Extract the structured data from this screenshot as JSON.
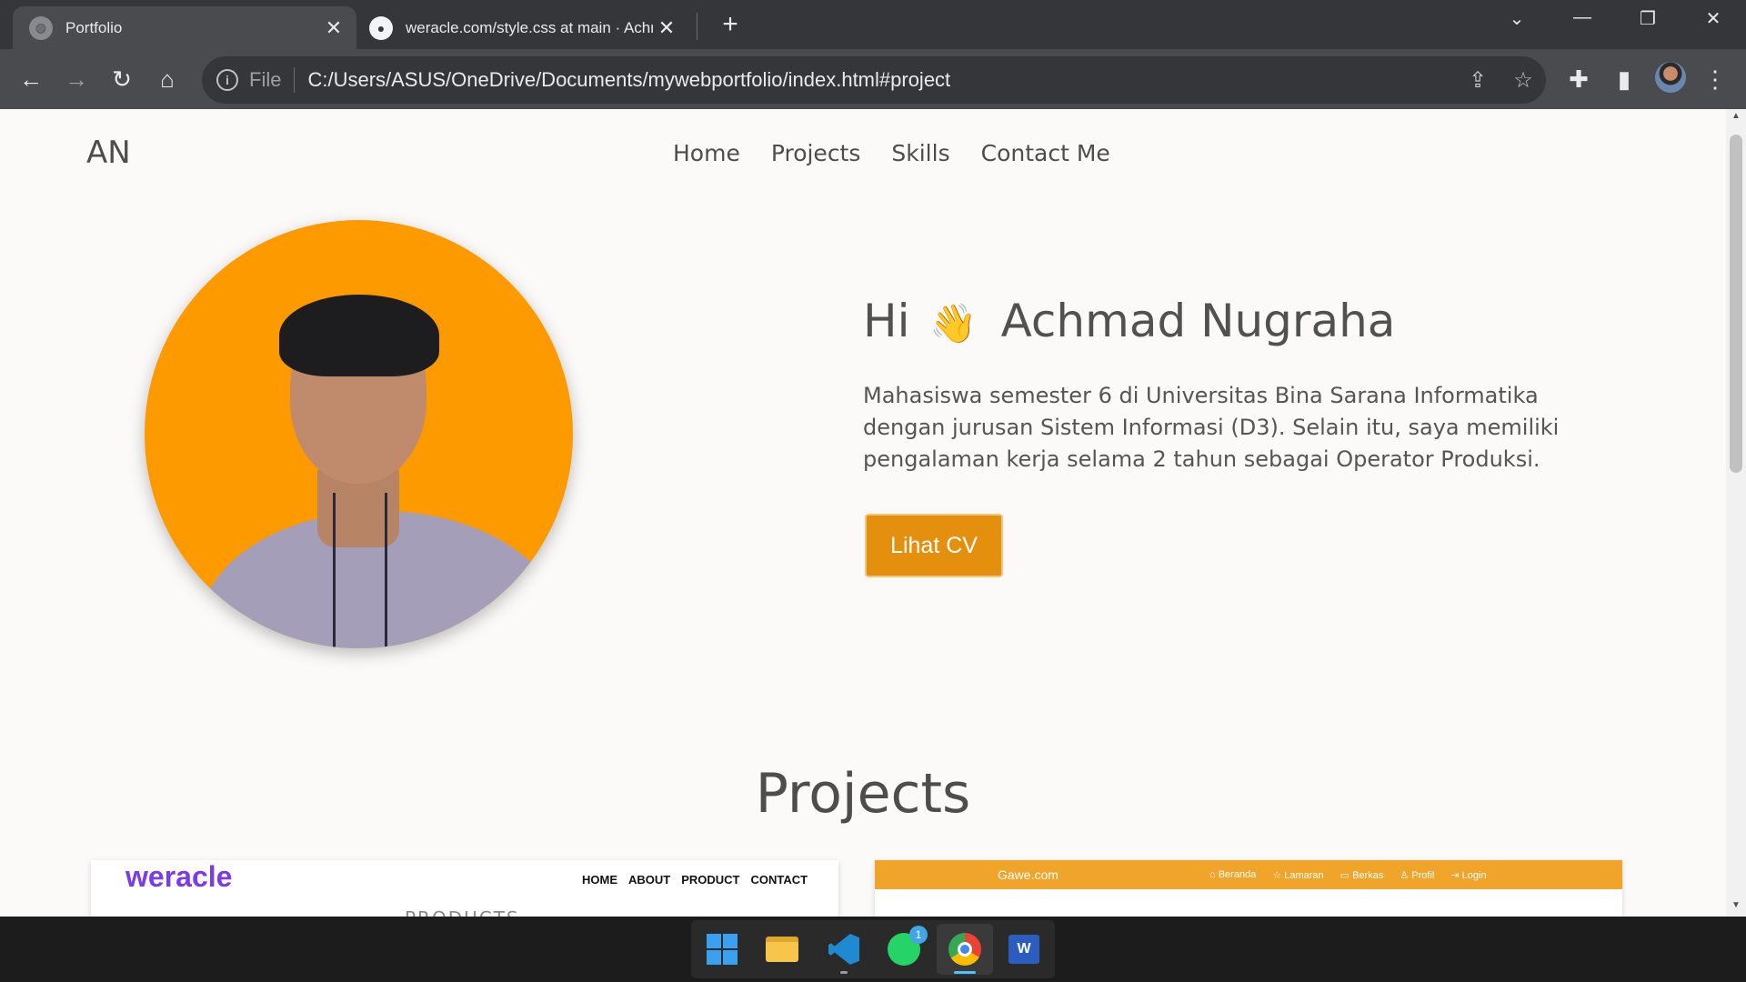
{
  "browser": {
    "tabs": [
      {
        "title": "Portfolio",
        "icon": "globe-icon",
        "active": true
      },
      {
        "title": "weracle.com/style.css at main · Achm",
        "icon": "github-icon",
        "active": false
      }
    ],
    "address": {
      "prefix": "File",
      "url": "C:/Users/ASUS/OneDrive/Documents/mywebportfolio/index.html#project"
    }
  },
  "page": {
    "logo": "AN",
    "nav": [
      "Home",
      "Projects",
      "Skills",
      "Contact Me"
    ],
    "hero": {
      "greeting": "Hi",
      "wave": "👋",
      "name": "Achmad Nugraha",
      "description": "Mahasiswa semester 6 di Universitas Bina Sarana Informatika dengan jurusan Sistem Informasi (D3). Selain itu, saya memiliki pengalaman kerja selama 2 tahun sebagai Operator Produksi.",
      "cv_button": "Lihat CV"
    },
    "projects": {
      "title": "Projects",
      "card1": {
        "brand": "weracle",
        "menu": [
          "HOME",
          "ABOUT",
          "PRODUCT",
          "CONTACT"
        ],
        "sub": "PRODUCTS"
      },
      "card2": {
        "site": "Gawe.com",
        "menu": [
          "⌂ Beranda",
          "☆ Lamaran",
          "▭ Berkas",
          "♙ Profil",
          "⇥ Login"
        ]
      }
    }
  },
  "taskbar": {
    "apps": [
      "start",
      "file-explorer",
      "vscode",
      "whatsapp",
      "chrome",
      "word"
    ],
    "whatsapp_badge": "1"
  },
  "colors": {
    "accent": "#e48f0e",
    "photo_bg": "#fd9a00",
    "page_bg": "#fbfaf9"
  }
}
